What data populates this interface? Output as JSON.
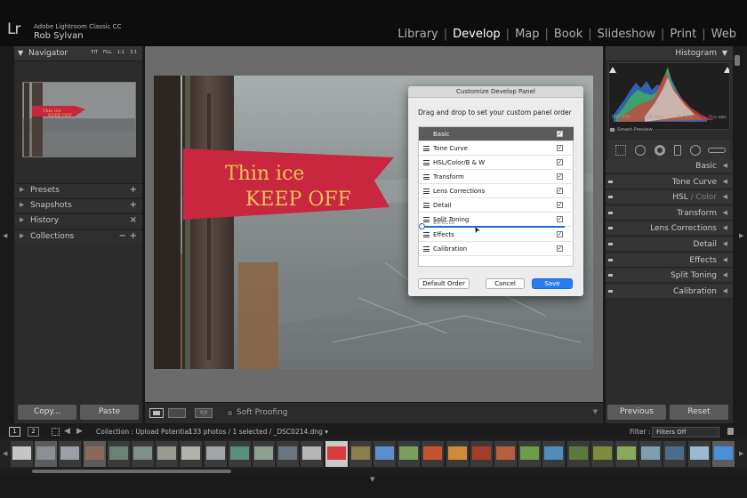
{
  "app": {
    "logo": "Lr",
    "name": "Adobe Lightroom Classic CC",
    "user": "Rob Sylvan"
  },
  "modules": [
    {
      "label": "Library",
      "active": false
    },
    {
      "label": "Develop",
      "active": true
    },
    {
      "label": "Map",
      "active": false
    },
    {
      "label": "Book",
      "active": false
    },
    {
      "label": "Slideshow",
      "active": false
    },
    {
      "label": "Print",
      "active": false
    },
    {
      "label": "Web",
      "active": false
    }
  ],
  "left_panel": {
    "navigator": {
      "title": "Navigator",
      "zoom_options": [
        "FIT",
        "FILL",
        "1:1",
        "3:1"
      ]
    },
    "sections": [
      {
        "label": "Presets",
        "control": "+"
      },
      {
        "label": "Snapshots",
        "control": "+"
      },
      {
        "label": "History",
        "control": "×"
      },
      {
        "label": "Collections",
        "control": "+",
        "control2": "−"
      }
    ],
    "copy_label": "Copy...",
    "paste_label": "Paste"
  },
  "photo": {
    "sign_line1": "Thin ice",
    "sign_line2": "KEEP OFF"
  },
  "toolbar": {
    "yy_label": "Y|Y",
    "soft_proofing_label": "Soft Proofing"
  },
  "dialog": {
    "title": "Customize Develop Panel",
    "instructions": "Drag and drop to set your custom panel order",
    "rows": [
      {
        "label": "Basic",
        "checked": true,
        "header": true
      },
      {
        "label": "Tone Curve",
        "checked": true
      },
      {
        "label": "HSL/Color/B & W",
        "checked": true
      },
      {
        "label": "Transform",
        "checked": true
      },
      {
        "label": "Lens Corrections",
        "checked": true
      },
      {
        "label": "Detail",
        "checked": true
      },
      {
        "label": "Split Toning",
        "checked": true
      },
      {
        "label": "Effects",
        "checked": true
      },
      {
        "label": "Calibration",
        "checked": true
      }
    ],
    "drag_ghost": "Effects",
    "check_glyph": "✓",
    "default_order_label": "Default Order",
    "cancel_label": "Cancel",
    "save_label": "Save"
  },
  "right_panel": {
    "histogram_title": "Histogram",
    "iso": "ISO 200",
    "focal": "24 mm",
    "aperture": "f / 4.0",
    "shutter": "¹⁄₁₀₀ sec",
    "smart_preview": "Smart Preview",
    "panels": [
      {
        "label": "Basic"
      },
      {
        "label": "Tone Curve"
      },
      {
        "label": "HSL",
        "suffix": " / Color"
      },
      {
        "label": "Transform"
      },
      {
        "label": "Lens Corrections"
      },
      {
        "label": "Detail"
      },
      {
        "label": "Effects"
      },
      {
        "label": "Split Toning"
      },
      {
        "label": "Calibration"
      }
    ],
    "previous_label": "Previous",
    "reset_label": "Reset"
  },
  "filmstrip": {
    "page1": "1",
    "page2": "2",
    "collection": "Collection : Upload Potential",
    "selection": "133 photos / 1 selected / _DSC0214.dng ▾",
    "filter_label": "Filter :",
    "filter_value": "Filters Off",
    "thumb_colors": [
      "#c5c5c5",
      "#8a8f96",
      "#9aa0a5",
      "#8b6a5a",
      "#6c8076",
      "#7f8f8a",
      "#9a9a92",
      "#b2b2ad",
      "#a0a4a6",
      "#5a8e7e",
      "#8f9f90",
      "#6a7580",
      "#b6b6b6",
      "#d93c3c",
      "#8a7d4e",
      "#5d8fcf",
      "#7aa05f",
      "#c3542c",
      "#d08a3a",
      "#a33d2a",
      "#b85d3d",
      "#6e9c4a",
      "#4c8fbd",
      "#5a7a3e",
      "#7d8c3d",
      "#8aaa5a",
      "#7e9fb0",
      "#4a6e8a",
      "#9ab9d5",
      "#4a90d9"
    ],
    "thumb_highlight": [
      false,
      true,
      false,
      true,
      false,
      false,
      false,
      false,
      false,
      false,
      false,
      false,
      false,
      true,
      false,
      false,
      false,
      false,
      false,
      false,
      false,
      false,
      false,
      false,
      false,
      false,
      false,
      false,
      false,
      true
    ]
  }
}
